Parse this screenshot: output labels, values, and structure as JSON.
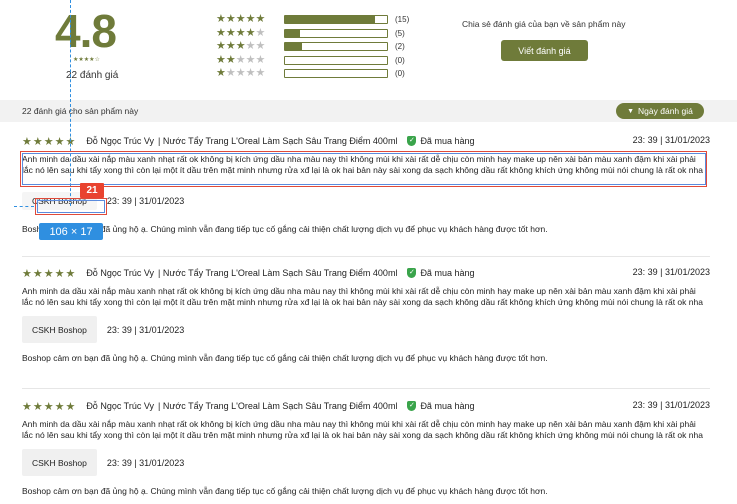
{
  "summary": {
    "average": "4.8",
    "mini_stars": "★★★★☆",
    "count_label": "22 đánh giá",
    "distribution": [
      {
        "stars": 5,
        "count": "(15)",
        "fraction": 0.88
      },
      {
        "stars": 4,
        "count": "(5)",
        "fraction": 0.15
      },
      {
        "stars": 3,
        "count": "(2)",
        "fraction": 0.17
      },
      {
        "stars": 2,
        "count": "(0)",
        "fraction": 0
      },
      {
        "stars": 1,
        "count": "(0)",
        "fraction": 0
      }
    ],
    "share_text": "Chia sẻ đánh giá của bạn về sản phẩm này",
    "write_button": "Viết đánh giá"
  },
  "filter": {
    "label": "22 đánh giá cho sản phẩm này",
    "sort_button": "Ngày đánh giá"
  },
  "reviews": [
    {
      "stars": "★★★★★",
      "author": "Đỗ Ngọc Trúc Vy",
      "product": "| Nước Tẩy Trang L'Oreal Làm Sạch Sâu Trang Điểm 400ml",
      "verified": "Đã mua hàng",
      "date": "23: 39 | 31/01/2023",
      "body": "Anh minh da dầu xài nắp màu xanh nhạt rất ok không bị kích ứng dầu nha màu nay thì không mùi khi xài rất dễ chịu còn minh hay make up nên xài bản màu xanh đậm khi xài phải lắc nó lên sau khi tẩy xong thì còn lại một ít dầu trên mặt minh nhưng rửa xđ lại là ok hai bản này sài xong da sạch không dầu rất không khích ứng không mùi nói chung là rất ok nha",
      "shop_name": "CSKH Boshop",
      "shop_date": "23: 39 | 31/01/2023",
      "shop_reply": "Boshop cảm ơn bạn đã ủng hộ ạ. Chúng mình vẫn đang tiếp tục cố gắng cải thiện chất lượng dịch vụ để phục vụ khách hàng được tốt hơn."
    },
    {
      "stars": "★★★★★",
      "author": "Đỗ Ngọc Trúc Vy",
      "product": "| Nước Tẩy Trang L'Oreal Làm Sạch Sâu Trang Điểm 400ml",
      "verified": "Đã mua hàng",
      "date": "23: 39 | 31/01/2023",
      "body": "Anh minh da dầu xài nắp màu xanh nhạt rất ok không bị kích ứng dầu nha màu nay thì không mùi khi xài rất dễ chịu còn minh hay make up nên xài bản màu xanh đậm khi xài phải lắc nó lên sau khi tẩy xong thì còn lại một ít dầu trên mặt minh nhưng rửa xđ lại là ok hai bản này sài xong da sạch không dầu rất không khích ứng không mùi nói chung là rất ok nha",
      "shop_name": "CSKH Boshop",
      "shop_date": "23: 39 | 31/01/2023",
      "shop_reply": "Boshop cảm ơn bạn đã ủng hộ ạ. Chúng mình vẫn đang tiếp tục cố gắng cải thiện chất lượng dịch vụ để phục vụ khách hàng được tốt hơn."
    },
    {
      "stars": "★★★★★",
      "author": "Đỗ Ngọc Trúc Vy",
      "product": "| Nước Tẩy Trang L'Oreal Làm Sạch Sâu Trang Điểm 400ml",
      "verified": "Đã mua hàng",
      "date": "23: 39 | 31/01/2023",
      "body": "Anh minh da dầu xài nắp màu xanh nhạt rất ok không bị kích ứng dầu nha màu nay thì không mùi khi xài rất dễ chịu còn minh hay make up nên xài bản màu xanh đậm khi xài phải lắc nó lên sau khi tẩy xong thì còn lại một ít dầu trên mặt minh nhưng rửa xđ lại là ok hai bản này sài xong da sạch không dầu rất không khích ứng không mùi nói chung là rất ok nha",
      "shop_name": "CSKH Boshop",
      "shop_date": "23: 39 | 31/01/2023",
      "shop_reply": "Boshop cảm ơn bạn đã ủng hộ ạ. Chúng mình vẫn đang tiếp tục cố gắng cải thiện chất lượng dịch vụ để phục vụ khách hàng được tốt hơn."
    }
  ],
  "annotation": {
    "index_tag": "21",
    "size_tag": "106 × 17"
  },
  "colors": {
    "accent": "#6f7b3a",
    "verified": "#3aa44b",
    "annotation_red": "#e9432f",
    "annotation_blue": "#2f8fe0"
  }
}
